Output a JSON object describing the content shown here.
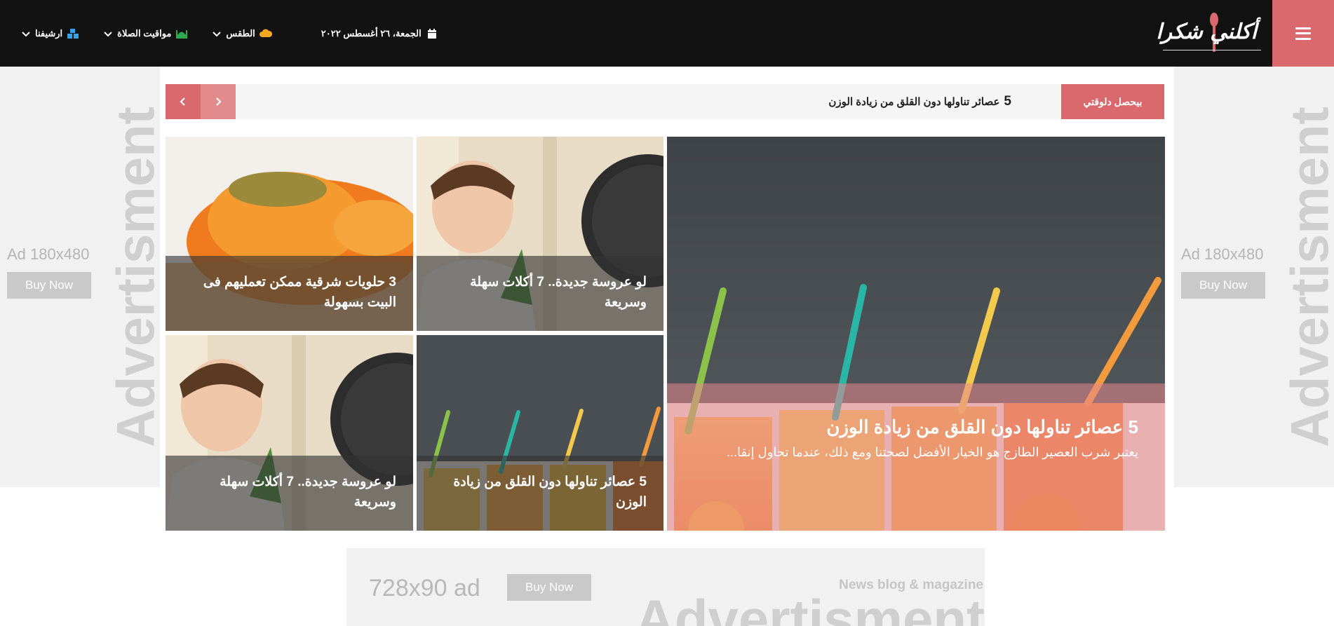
{
  "header": {
    "logo_text": "أكلني شكرا",
    "date": "الجمعة، ٢٦ أغسطس ٢٠٢٢",
    "weather": "الطقس",
    "prayer_times": "مواقيت الصلاة",
    "archive": "ارشيفنا"
  },
  "ticker": {
    "label": "بيحصل دلوقتي",
    "headline_number": "5",
    "headline": "عصائر تناولها دون القلق من زيادة الوزن"
  },
  "ads": {
    "side_size": "Ad 180x480",
    "side_buy": "Buy Now",
    "side_word": "Advertisment",
    "bottom_size": "728x90 ad",
    "bottom_buy": "Buy Now",
    "bottom_tag": "News blog & magazine",
    "bottom_word": "Advertisment"
  },
  "featured": {
    "title": "5 عصائر تناولها دون القلق من زيادة الوزن",
    "excerpt": "يعتبر شرب العصير الطازج هو الخيار الأفضل لصحتنا ومع ذلك، عندما تحاول إنقا..."
  },
  "cards": [
    {
      "title": "لو عروسة جديدة.. 7 أكلات سهلة وسريعة"
    },
    {
      "title": "3 حلويات شرقية ممكن تعمليهم فى البيت بسهولة"
    },
    {
      "title": "5 عصائر تناولها دون القلق من زيادة الوزن"
    },
    {
      "title": "لو عروسة جديدة.. 7 أكلات سهلة وسريعة"
    }
  ],
  "colors": {
    "accent": "#d9696c",
    "topbar": "#121212",
    "weather_icon": "#f5a623",
    "prayer_icon": "#2ea84f",
    "archive_icon": "#3aa0e6"
  }
}
